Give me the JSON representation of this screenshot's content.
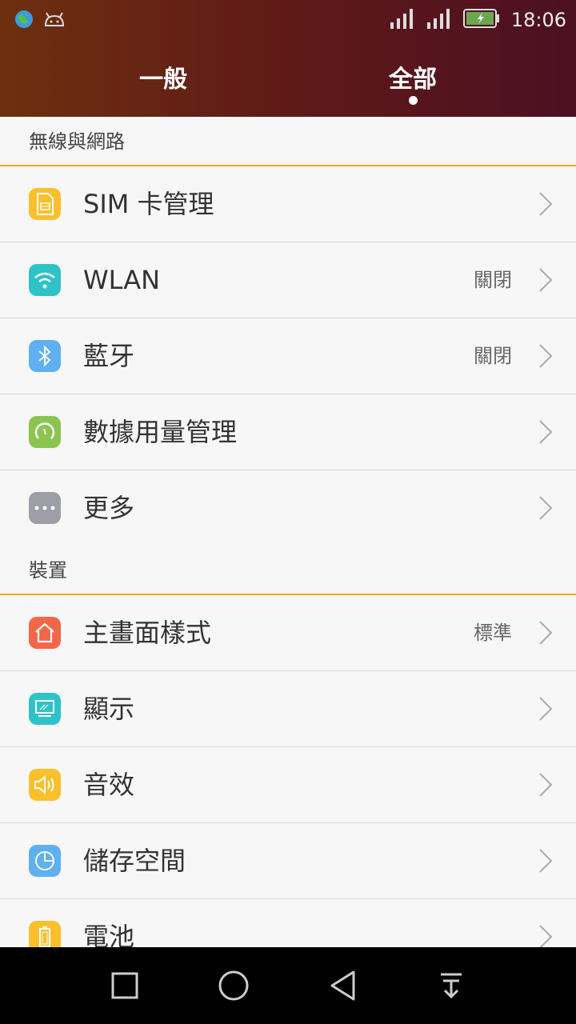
{
  "status_bar": {
    "time": "18:06",
    "icons": [
      "globe-icon",
      "android-icon",
      "signal-icon",
      "signal-icon",
      "battery-charging-icon"
    ]
  },
  "tabs": [
    {
      "label": "一般",
      "active": false
    },
    {
      "label": "全部",
      "active": true
    }
  ],
  "sections": [
    {
      "header": "無線與網路",
      "items": [
        {
          "label": "SIM 卡管理",
          "value": "",
          "icon": "sim-card-icon",
          "color": "#f9c02c"
        },
        {
          "label": "WLAN",
          "value": "關閉",
          "icon": "wifi-icon",
          "color": "#2ec3c8"
        },
        {
          "label": "藍牙",
          "value": "關閉",
          "icon": "bluetooth-icon",
          "color": "#5eb0f0"
        },
        {
          "label": "數據用量管理",
          "value": "",
          "icon": "data-usage-icon",
          "color": "#8cc450"
        },
        {
          "label": "更多",
          "value": "",
          "icon": "more-icon",
          "color": "#9e9ea6"
        }
      ]
    },
    {
      "header": "裝置",
      "items": [
        {
          "label": "主畫面樣式",
          "value": "標準",
          "icon": "home-icon",
          "color": "#f26748"
        },
        {
          "label": "顯示",
          "value": "",
          "icon": "display-icon",
          "color": "#2ec3c8"
        },
        {
          "label": "音效",
          "value": "",
          "icon": "sound-icon",
          "color": "#f9c02c"
        },
        {
          "label": "儲存空間",
          "value": "",
          "icon": "storage-icon",
          "color": "#5eb0f0"
        },
        {
          "label": "電池",
          "value": "",
          "icon": "battery-icon",
          "color": "#f9c02c"
        }
      ]
    }
  ],
  "nav_bar": {
    "buttons": [
      "recent-apps-icon",
      "home-circle-icon",
      "back-icon",
      "pull-down-icon"
    ]
  }
}
